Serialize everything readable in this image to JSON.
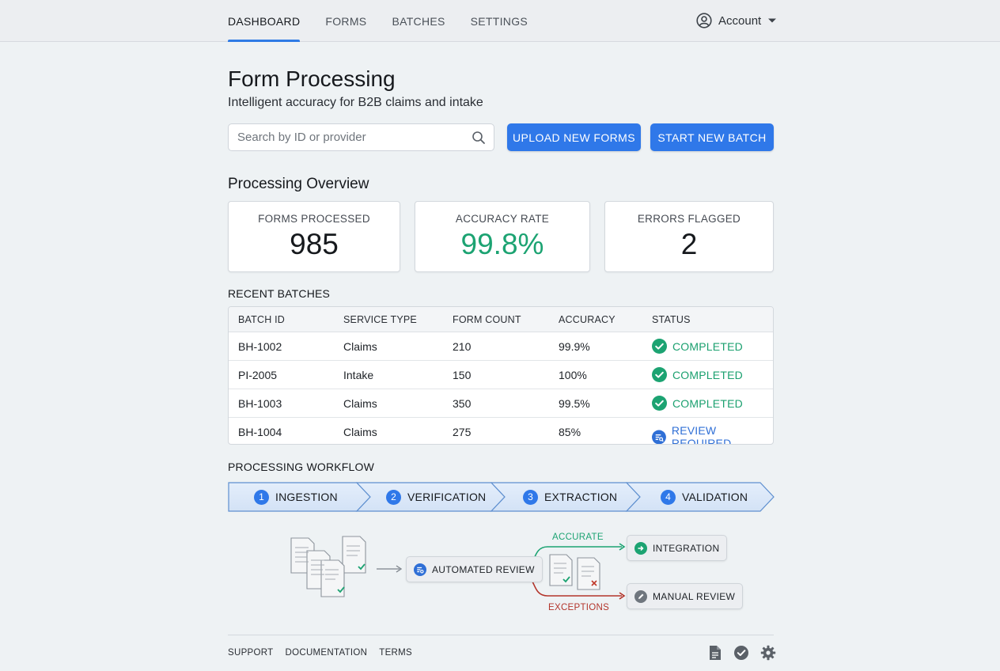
{
  "nav": {
    "tabs": [
      {
        "label": "DASHBOARD",
        "active": true
      },
      {
        "label": "FORMS",
        "active": false
      },
      {
        "label": "BATCHES",
        "active": false
      },
      {
        "label": "SETTINGS",
        "active": false
      }
    ],
    "account_label": "Account",
    "account_icon": "user-circle-icon"
  },
  "header": {
    "title": "Form Processing",
    "subtitle": "Intelligent accuracy for B2B claims and intake"
  },
  "search": {
    "placeholder": "Search by ID or provider",
    "value": ""
  },
  "actions": {
    "upload_label": "UPLOAD NEW FORMS",
    "batch_label": "START NEW BATCH"
  },
  "overview": {
    "title": "Processing Overview",
    "stats": [
      {
        "label": "FORMS PROCESSED",
        "value": "985"
      },
      {
        "label": "ACCURACY RATE",
        "value": "99.8%"
      },
      {
        "label": "ERRORS FLAGGED",
        "value": "2"
      }
    ]
  },
  "recent_batches": {
    "title": "RECENT BATCHES",
    "columns": [
      "BATCH ID",
      "SERVICE TYPE",
      "FORM COUNT",
      "ACCURACY",
      "STATUS"
    ],
    "rows": [
      {
        "id": "BH-1002",
        "service": "Claims",
        "count": "210",
        "accuracy": "99.9%",
        "status": "COMPLETED"
      },
      {
        "id": "PI-2005",
        "service": "Intake",
        "count": "150",
        "accuracy": "100%",
        "status": "COMPLETED"
      },
      {
        "id": "BH-1003",
        "service": "Claims",
        "count": "350",
        "accuracy": "99.5%",
        "status": "COMPLETED"
      },
      {
        "id": "BH-1004",
        "service": "Claims",
        "count": "275",
        "accuracy": "85%",
        "status": "REVIEW REQUIRED"
      }
    ]
  },
  "workflow": {
    "title": "PROCESSING WORKFLOW",
    "steps": [
      {
        "num": "1",
        "label": "INGESTION"
      },
      {
        "num": "2",
        "label": "VERIFICATION"
      },
      {
        "num": "3",
        "label": "EXTRACTION"
      },
      {
        "num": "4",
        "label": "VALIDATION"
      }
    ],
    "diagram": {
      "review_node": "AUTOMATED REVIEW",
      "accurate_label": "ACCURATE",
      "exceptions_label": "EXCEPTIONS",
      "integration_node": "INTEGRATION",
      "manual_node": "MANUAL REVIEW"
    }
  },
  "footer": {
    "links": [
      "SUPPORT",
      "DOCUMENTATION",
      "TERMS"
    ],
    "icons": [
      "document-icon",
      "check-circle-icon",
      "gear-icon"
    ]
  },
  "colors": {
    "accent": "#2f78e9",
    "success": "#1ca372",
    "review": "#2f6fd6",
    "exception": "#b3352b"
  }
}
